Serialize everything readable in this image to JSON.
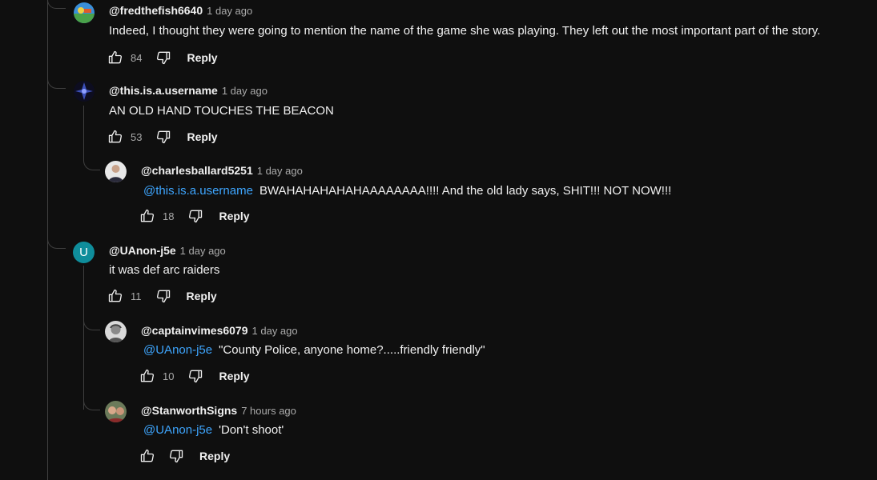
{
  "reply_label": "Reply",
  "icons": {
    "like": "thumbs-up-icon",
    "dislike": "thumbs-down-icon"
  },
  "colors": {
    "background": "#0f0f0f",
    "text": "#f1f1f1",
    "muted": "#aaaaaa",
    "mention": "#3ea6ff",
    "avatar_u": "#0f8d9b"
  },
  "comments": [
    {
      "author": "@fredthefish6640",
      "time": "1 day ago",
      "mention": "",
      "text": "Indeed, I thought they were going to mention the name of the game she was playing. They left out the most important part of the story.",
      "likes": "84"
    },
    {
      "author": "@this.is.a.username",
      "time": "1 day ago",
      "mention": "",
      "text": "AN OLD HAND TOUCHES THE BEACON",
      "likes": "53"
    },
    {
      "author": "@charlesballard5251",
      "time": "1 day ago",
      "mention": "@this.is.a.username",
      "text": "BWAHAHAHAHAHAAAAAAAA!!!!  And the old lady says, SHIT!!!  NOT NOW!!!",
      "likes": "18"
    },
    {
      "author": "@UAnon-j5e",
      "time": "1 day ago",
      "mention": "",
      "text": "it was def arc raiders",
      "likes": "11",
      "avatar_letter": "U"
    },
    {
      "author": "@captainvimes6079",
      "time": "1 day ago",
      "mention": "@UAnon-j5e",
      "text": "\"County Police, anyone home?.....friendly friendly\"",
      "likes": "10"
    },
    {
      "author": "@StanworthSigns",
      "time": "7 hours ago",
      "mention": "@UAnon-j5e",
      "text": "'Don't shoot'",
      "likes": ""
    }
  ]
}
